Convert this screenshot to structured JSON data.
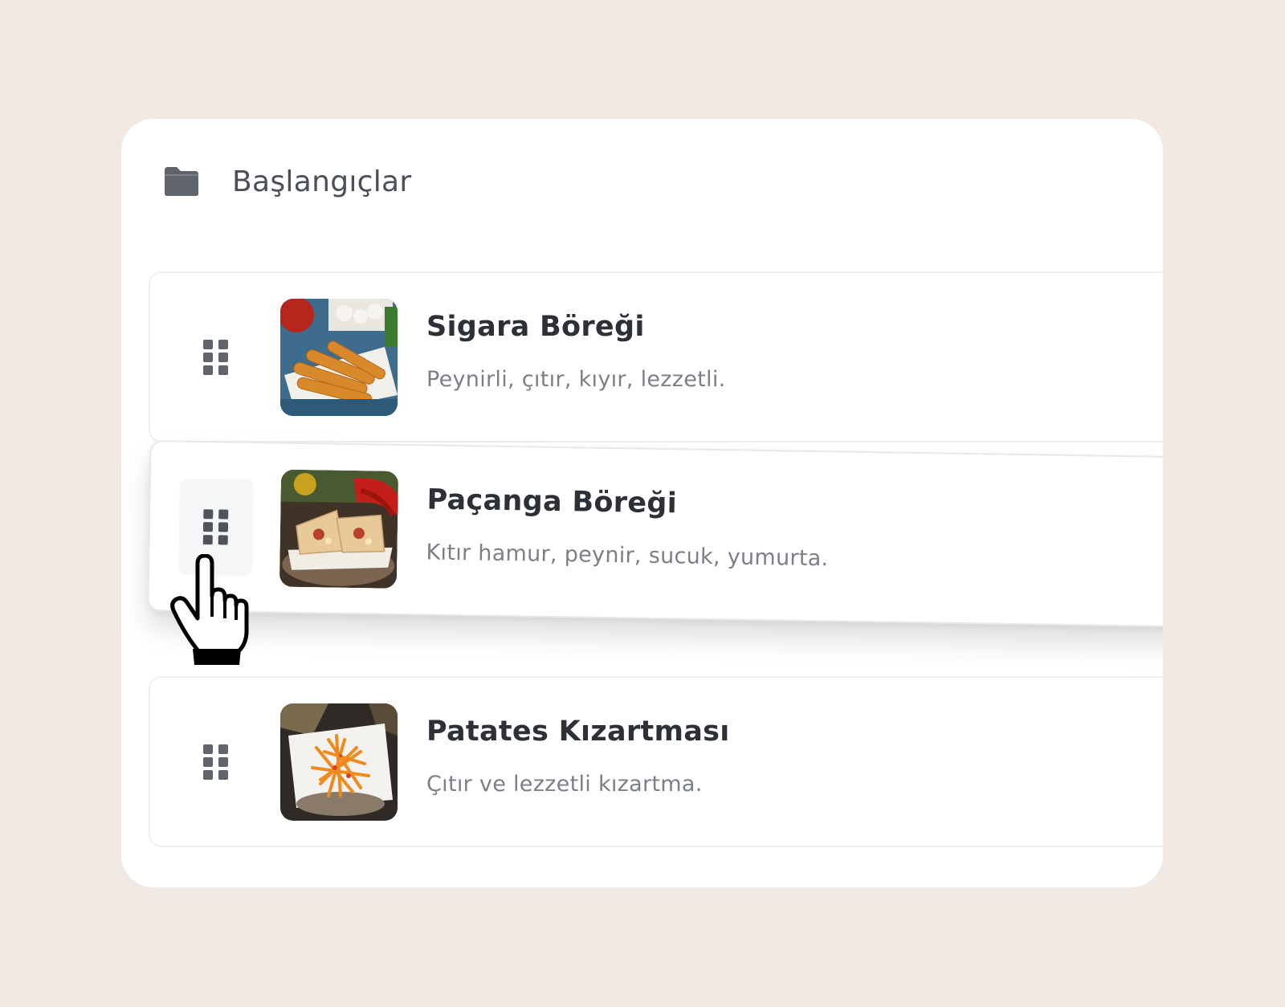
{
  "category": {
    "title": "Başlangıçlar",
    "icon": "folder-icon"
  },
  "items": [
    {
      "name": "Sigara Böreği",
      "description": "Peynirli, çıtır, kıyır, lezzetli.",
      "image": "sigara-boregi-photo"
    },
    {
      "name": "Paçanga Böreği",
      "description": "Kıtır hamur, peynir, sucuk, yumurta.",
      "image": "pacanga-boregi-photo"
    },
    {
      "name": "Patates Kızartması",
      "description": "Çıtır ve lezzetli kızartma.",
      "image": "patates-kizartmasi-photo"
    }
  ],
  "drag_state": {
    "dragging_item_index": 1,
    "cursor": "hand-pointer-icon"
  },
  "colors": {
    "page_background": "#f0e9e4",
    "card_background": "#ffffff",
    "title_text": "#2d3037",
    "description_text": "#7b7f86",
    "icon_gray": "#5f646c"
  }
}
